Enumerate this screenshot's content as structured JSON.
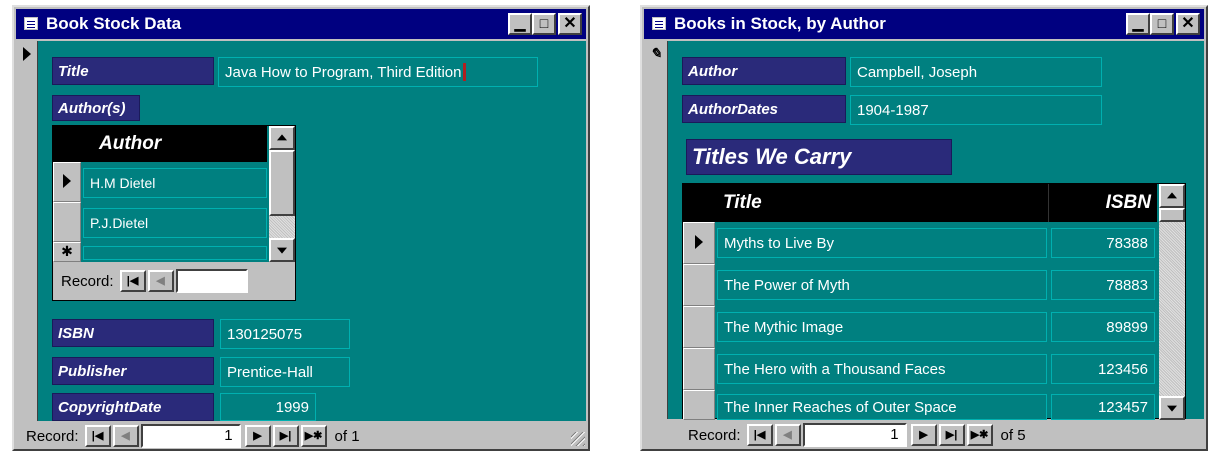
{
  "left_window": {
    "title": "Book Stock Data",
    "title_label": "Title",
    "title_value": "Java How to Program, Third Edition",
    "authors_label": "Author(s)",
    "subform": {
      "header": "Author",
      "rows": [
        "H.M Dietel",
        "P.J.Dietel"
      ],
      "new_row_marker": "✱",
      "record_label": "Record:"
    },
    "isbn_label": "ISBN",
    "isbn_value": "130125075",
    "publisher_label": "Publisher",
    "publisher_value": "Prentice-Hall",
    "copyright_label": "CopyrightDate",
    "copyright_value": "1999",
    "record_label": "Record:",
    "record_current": "1",
    "record_of": "of 1"
  },
  "right_window": {
    "title": "Books in Stock, by Author",
    "author_label": "Author",
    "author_value": "Campbell, Joseph",
    "dates_label": "AuthorDates",
    "dates_value": "1904-1987",
    "titles_heading": "Titles We Carry",
    "col_title": "Title",
    "col_isbn": "ISBN",
    "rows": [
      {
        "title": "Myths to Live By",
        "isbn": "78388"
      },
      {
        "title": "The Power of Myth",
        "isbn": "78883"
      },
      {
        "title": "The Mythic Image",
        "isbn": "89899"
      },
      {
        "title": "The Hero with a Thousand Faces",
        "isbn": "123456"
      },
      {
        "title": "The Inner Reaches of Outer Space",
        "isbn": "123457"
      }
    ],
    "record_label": "Record:",
    "record_current": "1",
    "record_of": "of 5"
  },
  "buttons": {
    "minimize": "▁",
    "maximize": "□",
    "close": "✕",
    "first": "|◀",
    "prev": "◀",
    "next": "▶",
    "last": "▶|",
    "new": "▶✱"
  },
  "colors": {
    "form_bg": "#008080",
    "label_bg": "#2a2a7a",
    "titlebar": "#000080"
  }
}
